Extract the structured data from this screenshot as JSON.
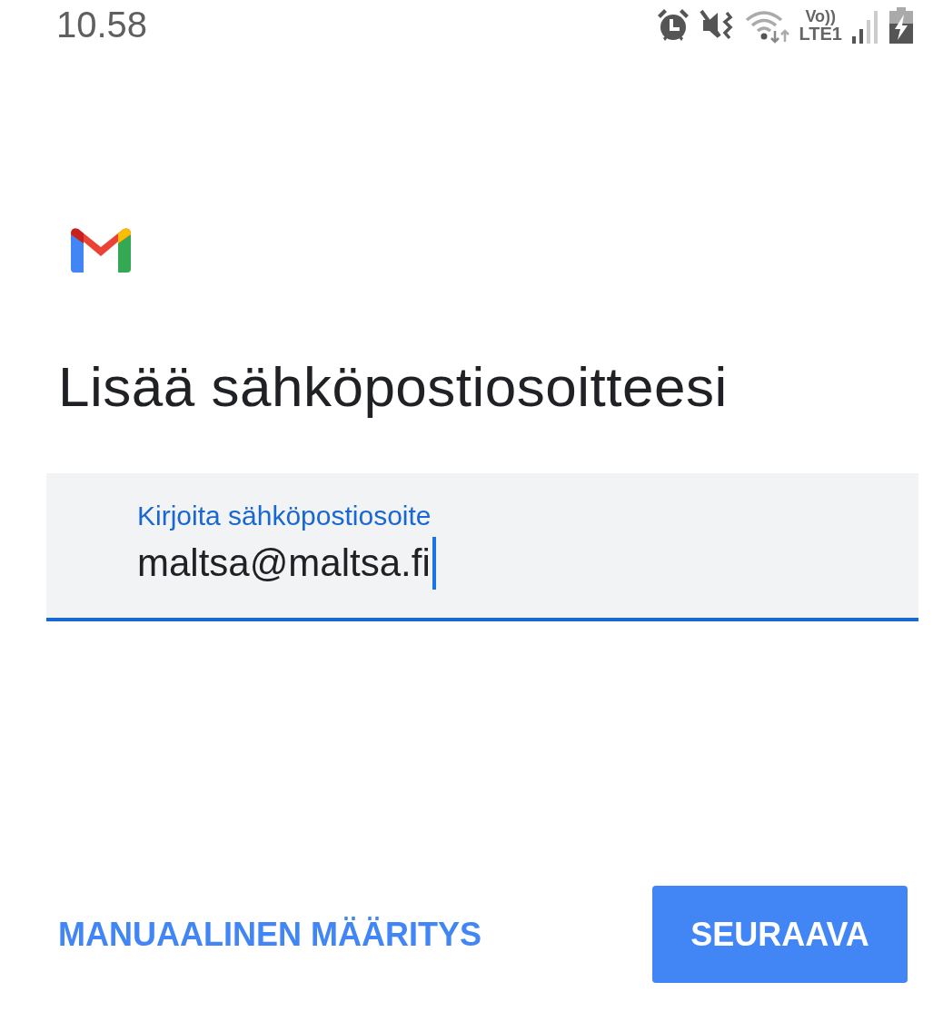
{
  "status_bar": {
    "time": "10.58",
    "network_label_top": "Vo))",
    "network_label_bottom": "LTE1"
  },
  "title": "Lisää sähköpostiosoitteesi",
  "email_field": {
    "label": "Kirjoita sähköpostiosoite",
    "value": "maltsa@maltsa.fi",
    "focused": true
  },
  "buttons": [
    {
      "label": "MANUAALINEN MÄÄRITYS",
      "kind": "text"
    },
    {
      "label": "SEURAAVA",
      "kind": "filled"
    }
  ]
}
